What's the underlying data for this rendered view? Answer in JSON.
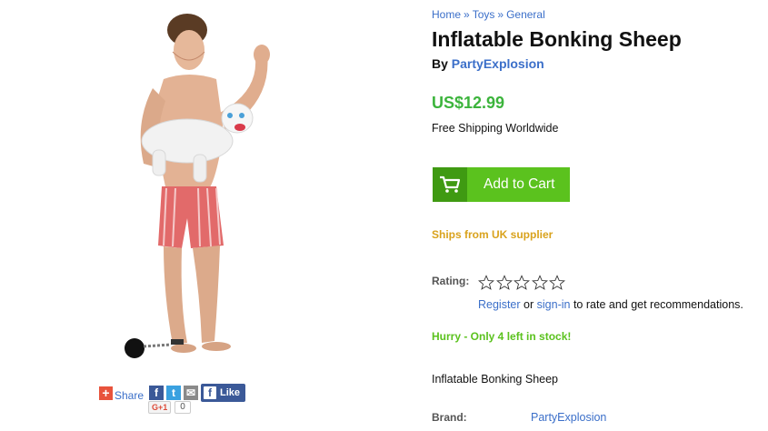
{
  "breadcrumb": {
    "items": [
      "Home",
      "Toys",
      "General"
    ],
    "separator": "»"
  },
  "product": {
    "title": "Inflatable Bonking Sheep",
    "by_label": "By",
    "seller": "PartyExplosion",
    "price": "US$12.99",
    "shipping": "Free Shipping Worldwide",
    "cart_label": "Add to Cart",
    "ships_from": "Ships from UK supplier",
    "rating_label": "Rating:",
    "rating_value": 0,
    "rating_max": 5,
    "register_link": "Register",
    "or_text": "or",
    "signin_link": "sign-in",
    "rate_suffix": "to rate and get recommendations.",
    "stock_notice": "Hurry - Only 4 left in stock!",
    "short_description": "Inflatable Bonking Sheep",
    "brand_label": "Brand:",
    "brand_value": "PartyExplosion"
  },
  "social": {
    "share_label": "Share",
    "like_label": "Like",
    "gplus_label": "G+1",
    "gplus_count": "0"
  },
  "colors": {
    "link": "#3b6fc9",
    "price": "#3cb43c",
    "cart_button": "#5bc21e",
    "ships_from": "#d9a21c",
    "stock": "#5bc21e"
  }
}
